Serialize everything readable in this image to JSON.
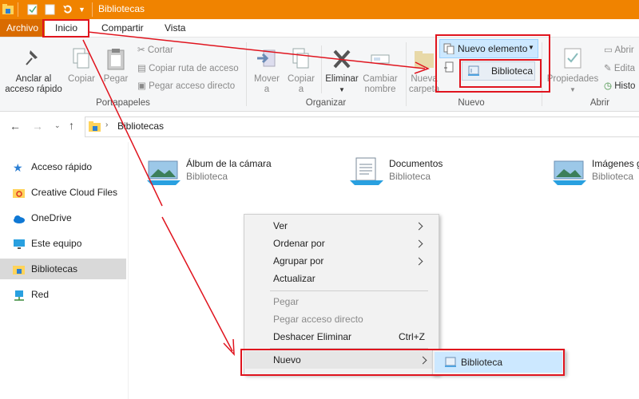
{
  "window": {
    "title": "Bibliotecas"
  },
  "tabs": [
    "Archivo",
    "Inicio",
    "Compartir",
    "Vista"
  ],
  "ribbon": {
    "portapapeles": {
      "pin_label_1": "Anclar al",
      "pin_label_2": "acceso rápido",
      "copy": "Copiar",
      "paste": "Pegar",
      "cut": "Cortar",
      "copy_path": "Copiar ruta de acceso",
      "paste_shortcut": "Pegar acceso directo",
      "group": "Portapapeles"
    },
    "organizar": {
      "move_1": "Mover",
      "move_2": "a",
      "copy_1": "Copiar",
      "copy_2": "a",
      "delete": "Eliminar",
      "rename_1": "Cambiar",
      "rename_2": "nombre",
      "group": "Organizar"
    },
    "nuevo": {
      "folder_1": "Nueva",
      "folder_2": "carpeta",
      "new_item": "Nuevo elemento",
      "library": "Biblioteca",
      "group": "Nuevo"
    },
    "abrir": {
      "properties": "Propiedades",
      "open": "Abrir",
      "edit": "Edita",
      "history": "Histo",
      "group": "Abrir"
    }
  },
  "address": {
    "path": "Bibliotecas"
  },
  "nav": [
    {
      "label": "Acceso rápido"
    },
    {
      "label": "Creative Cloud Files"
    },
    {
      "label": "OneDrive"
    },
    {
      "label": "Este equipo"
    },
    {
      "label": "Bibliotecas"
    },
    {
      "label": "Red"
    }
  ],
  "libraries": [
    {
      "name": "Álbum de la cámara",
      "type": "Biblioteca"
    },
    {
      "name": "Documentos",
      "type": "Biblioteca"
    },
    {
      "name": "Imágenes g",
      "type": "Biblioteca"
    }
  ],
  "context_menu": {
    "view": "Ver",
    "sort": "Ordenar por",
    "group": "Agrupar por",
    "refresh": "Actualizar",
    "paste": "Pegar",
    "paste_shortcut": "Pegar acceso directo",
    "undo": "Deshacer Eliminar",
    "undo_shortcut": "Ctrl+Z",
    "new": "Nuevo"
  },
  "submenu": {
    "library": "Biblioteca"
  },
  "colors": {
    "titlebar": "#f08300",
    "archivo": "#d96b00",
    "annotation": "#e0141e",
    "selection": "#cce8ff"
  }
}
